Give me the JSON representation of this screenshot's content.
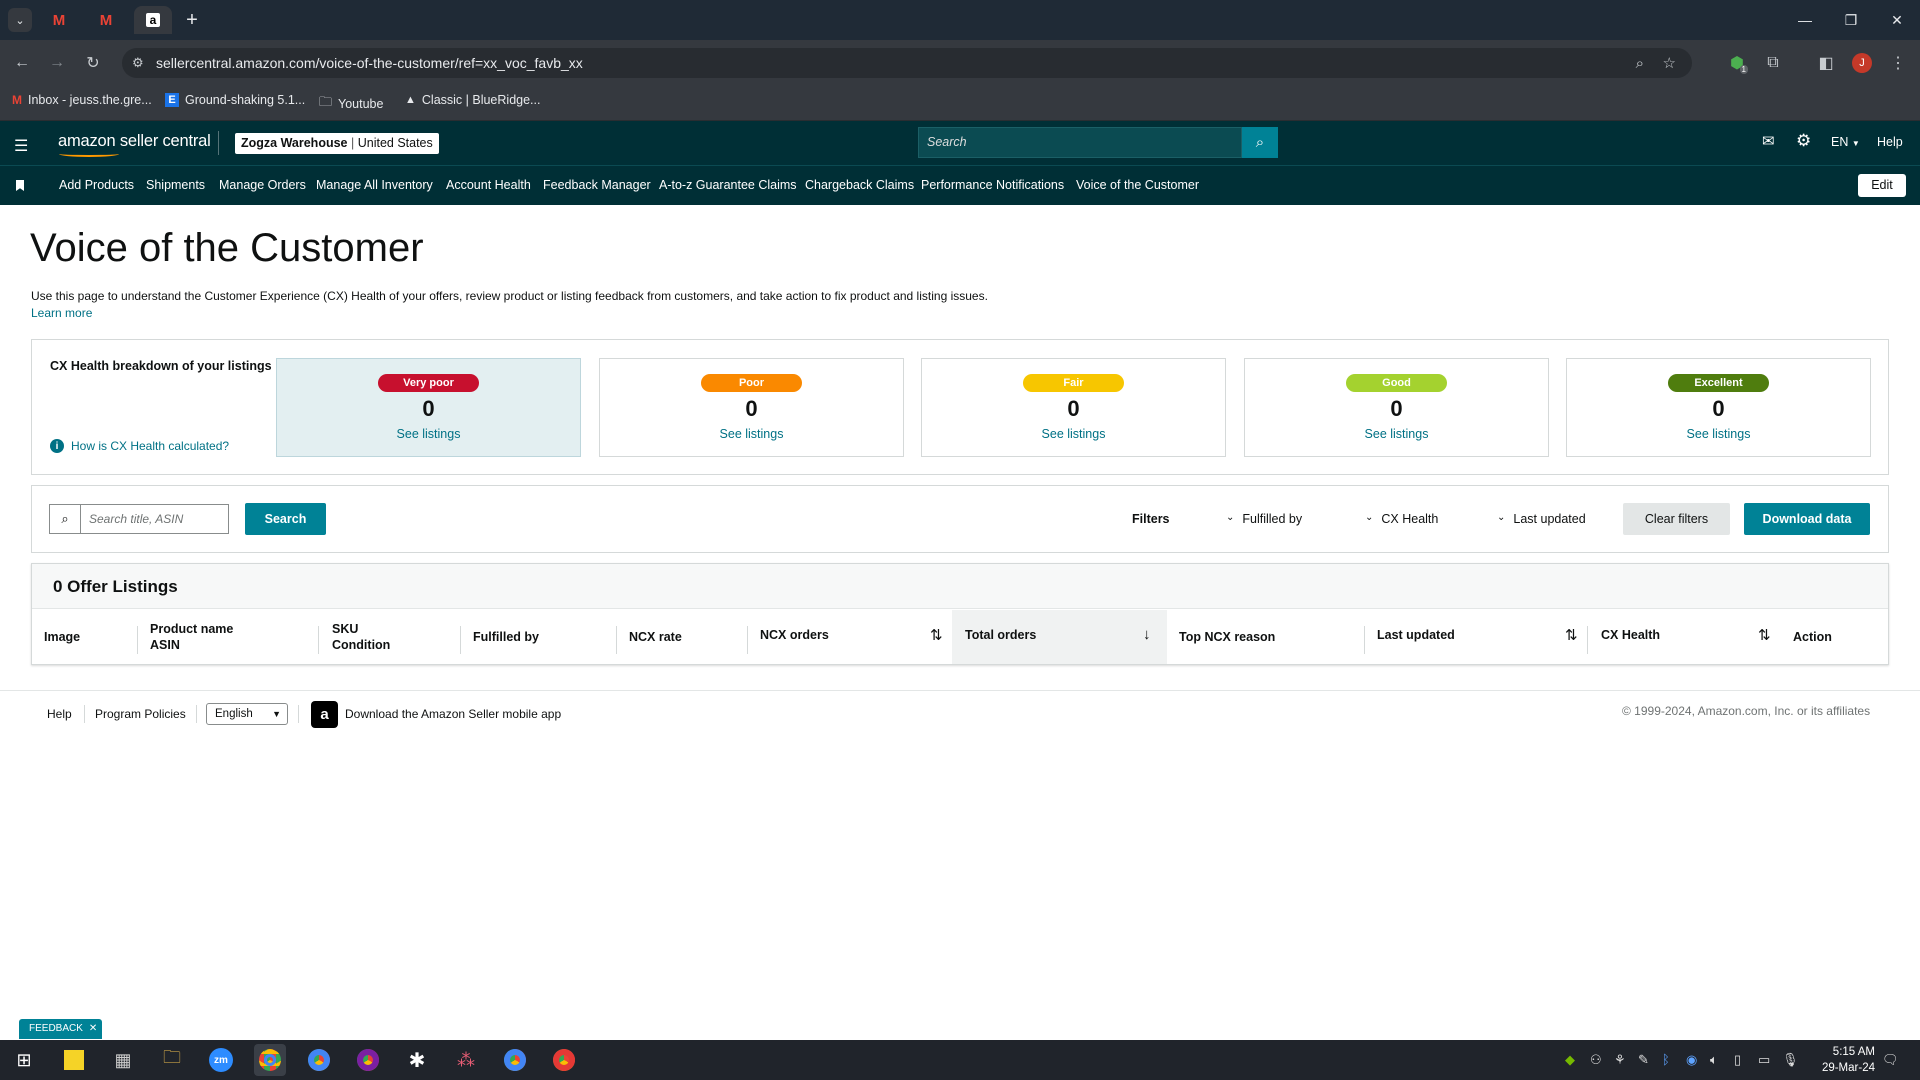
{
  "browser": {
    "tabs": [
      {
        "icon": "gmail-icon",
        "label": "M"
      },
      {
        "icon": "gmail-icon",
        "label": "M"
      },
      {
        "icon": "amazon-icon",
        "label": "a"
      }
    ],
    "new_tab": "+",
    "url": "sellercentral.amazon.com/voice-of-the-customer/ref=xx_voc_favb_xx",
    "profile_initial": "J",
    "extension_badge": "1",
    "bookmarks": [
      {
        "icon": "gmail-icon",
        "label": "Inbox - jeuss.the.gre..."
      },
      {
        "icon": "e-icon",
        "label": "Ground-shaking 5.1..."
      },
      {
        "icon": "folder-icon",
        "label": "Youtube"
      },
      {
        "icon": "mountain-icon",
        "label": "Classic | BlueRidge..."
      }
    ]
  },
  "header": {
    "logo": "amazon seller central",
    "store_name": "Zogza Warehouse",
    "store_region": "United States",
    "search_placeholder": "Search",
    "language": "EN",
    "help": "Help"
  },
  "nav": {
    "items": [
      "Add Products",
      "Shipments",
      "Manage Orders",
      "Manage All Inventory",
      "Account Health",
      "Feedback Manager",
      "A-to-z Guarantee Claims",
      "Chargeback Claims",
      "Performance Notifications",
      "Voice of the Customer"
    ],
    "edit": "Edit"
  },
  "page": {
    "title": "Voice of the Customer",
    "description": "Use this page to understand the Customer Experience (CX) Health of your offers, review product or listing feedback from customers, and take action to fix product and listing issues.",
    "learn_more": "Learn more"
  },
  "health": {
    "heading": "CX Health breakdown of your listings",
    "how_link": "How is CX Health calculated?",
    "cards": [
      {
        "label": "Very poor",
        "count": "0",
        "link": "See listings",
        "color": "#c7102e"
      },
      {
        "label": "Poor",
        "count": "0",
        "link": "See listings",
        "color": "#fa8900"
      },
      {
        "label": "Fair",
        "count": "0",
        "link": "See listings",
        "color": "#f7c600"
      },
      {
        "label": "Good",
        "count": "0",
        "link": "See listings",
        "color": "#a4d22f"
      },
      {
        "label": "Excellent",
        "count": "0",
        "link": "See listings",
        "color": "#4f7d0e"
      }
    ]
  },
  "filters": {
    "search_placeholder": "Search title, ASIN",
    "search_button": "Search",
    "label": "Filters",
    "fulfilled_by": "Fulfilled by",
    "cx_health": "CX Health",
    "last_updated": "Last updated",
    "clear": "Clear filters",
    "download": "Download data"
  },
  "listings": {
    "title": "0 Offer Listings",
    "columns": [
      {
        "line1": "Image",
        "line2": ""
      },
      {
        "line1": "Product name",
        "line2": "ASIN"
      },
      {
        "line1": "SKU",
        "line2": "Condition"
      },
      {
        "line1": "Fulfilled by",
        "line2": ""
      },
      {
        "line1": "NCX rate",
        "line2": ""
      },
      {
        "line1": "NCX orders",
        "line2": ""
      },
      {
        "line1": "Total orders",
        "line2": ""
      },
      {
        "line1": "Top NCX reason",
        "line2": ""
      },
      {
        "line1": "Last updated",
        "line2": ""
      },
      {
        "line1": "CX Health",
        "line2": ""
      },
      {
        "line1": "Action",
        "line2": ""
      }
    ]
  },
  "footer": {
    "help": "Help",
    "policies": "Program Policies",
    "language": "English",
    "app": "Download the Amazon Seller mobile app",
    "copyright": "© 1999-2024, Amazon.com, Inc. or its affiliates"
  },
  "feedback": "FEEDBACK",
  "taskbar": {
    "time": "5:15 AM",
    "date": "29-Mar-24"
  }
}
